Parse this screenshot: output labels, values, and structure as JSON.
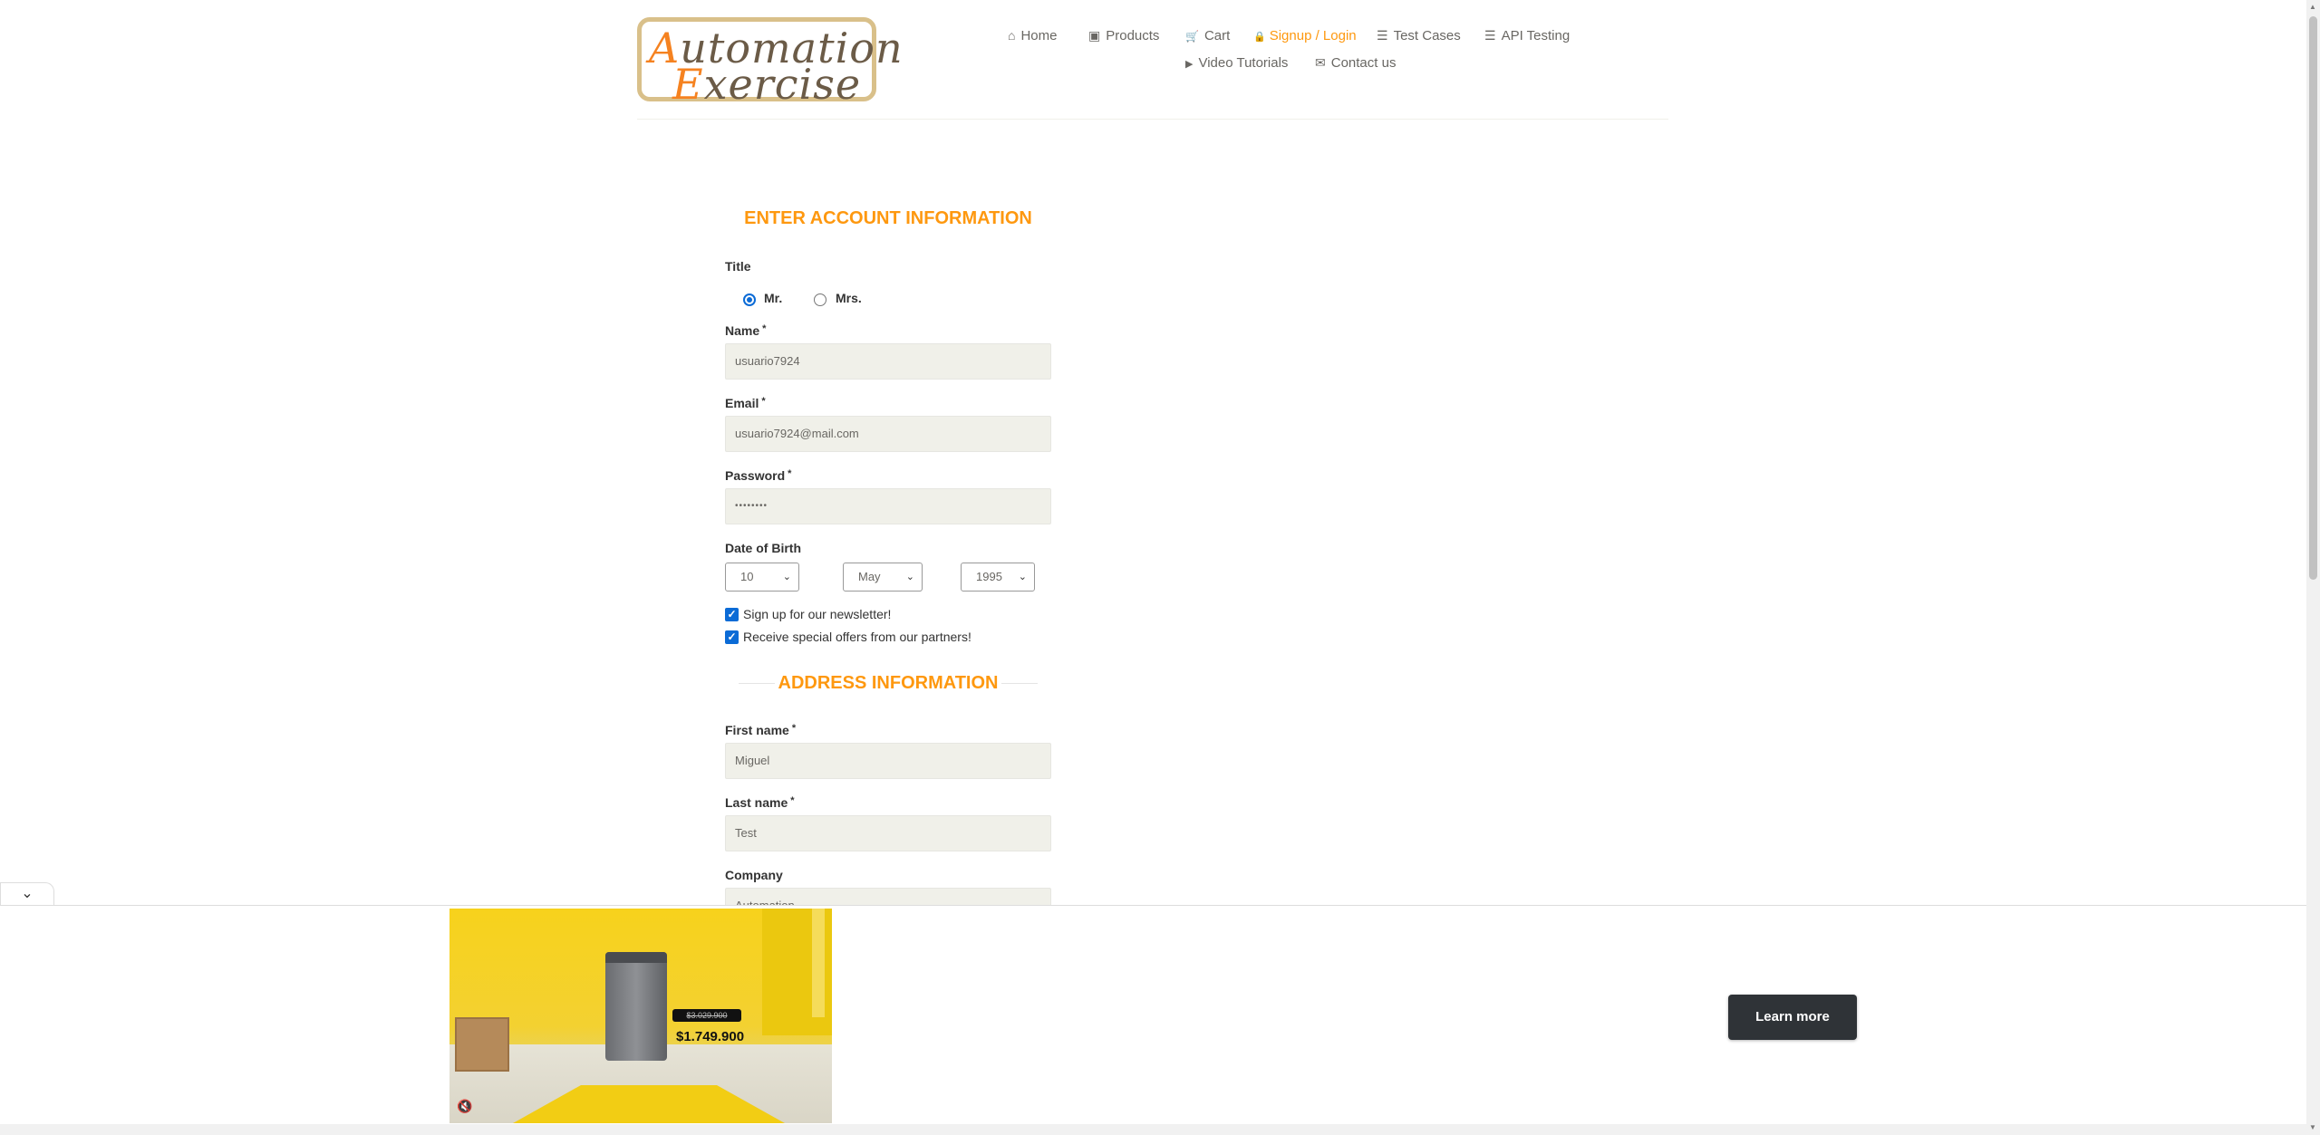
{
  "logo": {
    "line1_first": "A",
    "line1_rest": "utomation",
    "line2_first": "E",
    "line2_rest": "xercise"
  },
  "nav": {
    "items": [
      {
        "label": "Home",
        "icon": "home-icon",
        "glyph": "⌂"
      },
      {
        "label": "Products",
        "icon": "products-icon",
        "glyph": "▣"
      },
      {
        "label": "Cart",
        "icon": "cart-icon",
        "glyph": "🛒"
      },
      {
        "label": "Signup / Login",
        "icon": "lock-icon",
        "glyph": "🔒",
        "active": true
      },
      {
        "label": "Test Cases",
        "icon": "list-icon",
        "glyph": "☰"
      },
      {
        "label": "API Testing",
        "icon": "list-icon",
        "glyph": "☰"
      },
      {
        "label": "Video Tutorials",
        "icon": "youtube-icon",
        "glyph": "▶"
      },
      {
        "label": "Contact us",
        "icon": "envelope-icon",
        "glyph": "✉"
      }
    ]
  },
  "form": {
    "title": "ENTER ACCOUNT INFORMATION",
    "title_label": "Title",
    "title_options": [
      {
        "label": "Mr.",
        "checked": true
      },
      {
        "label": "Mrs.",
        "checked": false
      }
    ],
    "name_label": "Name",
    "name_value": "usuario7924",
    "email_label": "Email",
    "email_value": "usuario7924@mail.com",
    "password_label": "Password",
    "password_value": "••••••••",
    "required_mark": "*",
    "dob_label": "Date of Birth",
    "dob_day": "10",
    "dob_month": "May",
    "dob_year": "1995",
    "newsletter_label": "Sign up for our newsletter!",
    "newsletter_checked": true,
    "offers_label": "Receive special offers from our partners!",
    "offers_checked": true,
    "address_title": "ADDRESS INFORMATION",
    "first_name_label": "First name",
    "first_name_value": "Miguel",
    "last_name_label": "Last name",
    "last_name_value": "Test",
    "company_label": "Company",
    "company_value": "Automation"
  },
  "ad": {
    "toggle_icon": "chevron-down-icon",
    "old_price": "$3.029.900",
    "price": "$1.749.900",
    "learn_more": "Learn more",
    "mute_icon": "speaker-muted-icon"
  }
}
